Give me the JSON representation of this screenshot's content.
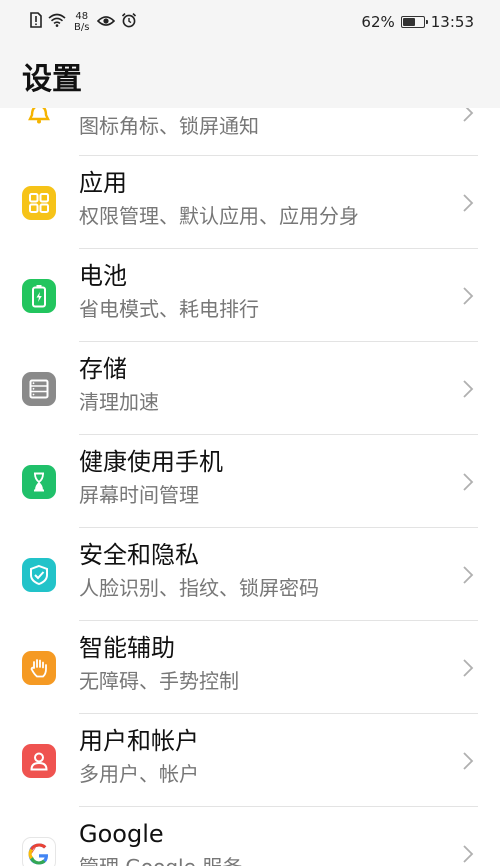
{
  "status": {
    "speed_value": "48",
    "speed_unit": "B/s",
    "battery": "62%",
    "battery_level": 0.62,
    "time": "13:53"
  },
  "header": {
    "title": "设置"
  },
  "items": [
    {
      "title": "",
      "subtitle": "图标角标、锁屏通知",
      "icon": "bell-icon",
      "color": "#F5B400"
    },
    {
      "title": "应用",
      "subtitle": "权限管理、默认应用、应用分身",
      "icon": "apps-grid-icon",
      "color": "#F6C318"
    },
    {
      "title": "电池",
      "subtitle": "省电模式、耗电排行",
      "icon": "battery-icon",
      "color": "#22C55E"
    },
    {
      "title": "存储",
      "subtitle": "清理加速",
      "icon": "storage-icon",
      "color": "#8A8A8A"
    },
    {
      "title": "健康使用手机",
      "subtitle": "屏幕时间管理",
      "icon": "hourglass-icon",
      "color": "#20C06A"
    },
    {
      "title": "安全和隐私",
      "subtitle": "人脸识别、指纹、锁屏密码",
      "icon": "shield-icon",
      "color": "#22C3C9"
    },
    {
      "title": "智能辅助",
      "subtitle": "无障碍、手势控制",
      "icon": "hand-icon",
      "color": "#F59A23"
    },
    {
      "title": "用户和帐户",
      "subtitle": "多用户、帐户",
      "icon": "user-icon",
      "color": "#EF5350"
    },
    {
      "title": "Google",
      "subtitle": "管理 Google 服务",
      "icon": "google-icon",
      "color": "#4285F4"
    }
  ]
}
